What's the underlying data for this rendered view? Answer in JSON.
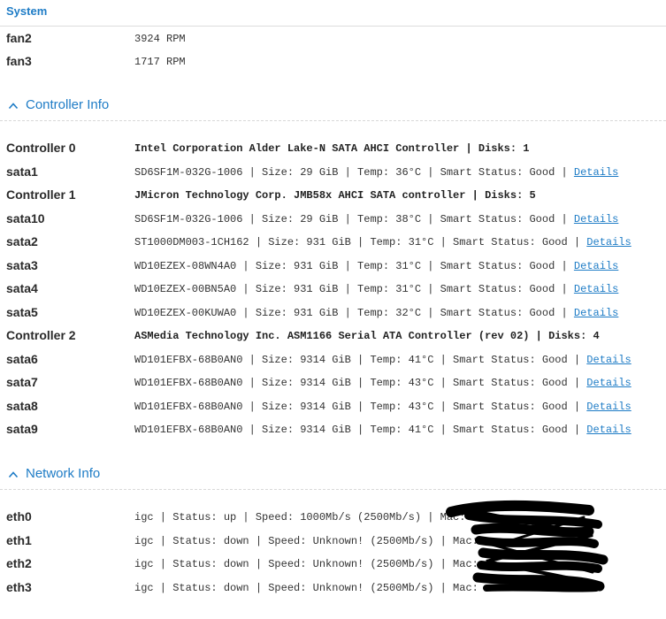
{
  "tabs": {
    "active": "System"
  },
  "system": {
    "fans": [
      {
        "label": "fan2",
        "value": "3924 RPM"
      },
      {
        "label": "fan3",
        "value": "1717 RPM"
      }
    ]
  },
  "controller_info": {
    "title": "Controller Info",
    "rows": [
      {
        "label": "Controller 0",
        "value": "Intel Corporation Alder Lake-N SATA AHCI Controller | Disks: 1"
      },
      {
        "label": "sata1",
        "value": "SD6SF1M-032G-1006 | Size: 29 GiB | Temp: 36°C | Smart Status: Good | ",
        "link": "Details"
      },
      {
        "label": "Controller 1",
        "value": "JMicron Technology Corp. JMB58x AHCI SATA controller | Disks: 5"
      },
      {
        "label": "sata10",
        "value": "SD6SF1M-032G-1006 | Size: 29 GiB | Temp: 38°C | Smart Status: Good | ",
        "link": "Details"
      },
      {
        "label": "sata2",
        "value": "ST1000DM003-1CH162 | Size: 931 GiB | Temp: 31°C | Smart Status: Good | ",
        "link": "Details"
      },
      {
        "label": "sata3",
        "value": "WD10EZEX-08WN4A0 | Size: 931 GiB | Temp: 31°C | Smart Status: Good | ",
        "link": "Details"
      },
      {
        "label": "sata4",
        "value": "WD10EZEX-00BN5A0 | Size: 931 GiB | Temp: 31°C | Smart Status: Good | ",
        "link": "Details"
      },
      {
        "label": "sata5",
        "value": "WD10EZEX-00KUWA0 | Size: 931 GiB | Temp: 32°C | Smart Status: Good | ",
        "link": "Details"
      },
      {
        "label": "Controller 2",
        "value": "ASMedia Technology Inc. ASM1166 Serial ATA Controller (rev 02) | Disks: 4"
      },
      {
        "label": "sata6",
        "value": "WD101EFBX-68B0AN0 | Size: 9314 GiB | Temp: 41°C | Smart Status: Good | ",
        "link": "Details"
      },
      {
        "label": "sata7",
        "value": "WD101EFBX-68B0AN0 | Size: 9314 GiB | Temp: 43°C | Smart Status: Good | ",
        "link": "Details"
      },
      {
        "label": "sata8",
        "value": "WD101EFBX-68B0AN0 | Size: 9314 GiB | Temp: 43°C | Smart Status: Good | ",
        "link": "Details"
      },
      {
        "label": "sata9",
        "value": "WD101EFBX-68B0AN0 | Size: 9314 GiB | Temp: 41°C | Smart Status: Good | ",
        "link": "Details"
      }
    ]
  },
  "network_info": {
    "title": "Network Info",
    "rows": [
      {
        "label": "eth0",
        "value": "igc | Status: up | Speed: 1000Mb/s (2500Mb/s) | Mac: "
      },
      {
        "label": "eth1",
        "value": "igc | Status: down | Speed: Unknown! (2500Mb/s) | Mac: "
      },
      {
        "label": "eth2",
        "value": "igc | Status: down | Speed: Unknown! (2500Mb/s) | Mac: "
      },
      {
        "label": "eth3",
        "value": "igc | Status: down | Speed: Unknown! (2500Mb/s) | Mac: "
      }
    ]
  }
}
